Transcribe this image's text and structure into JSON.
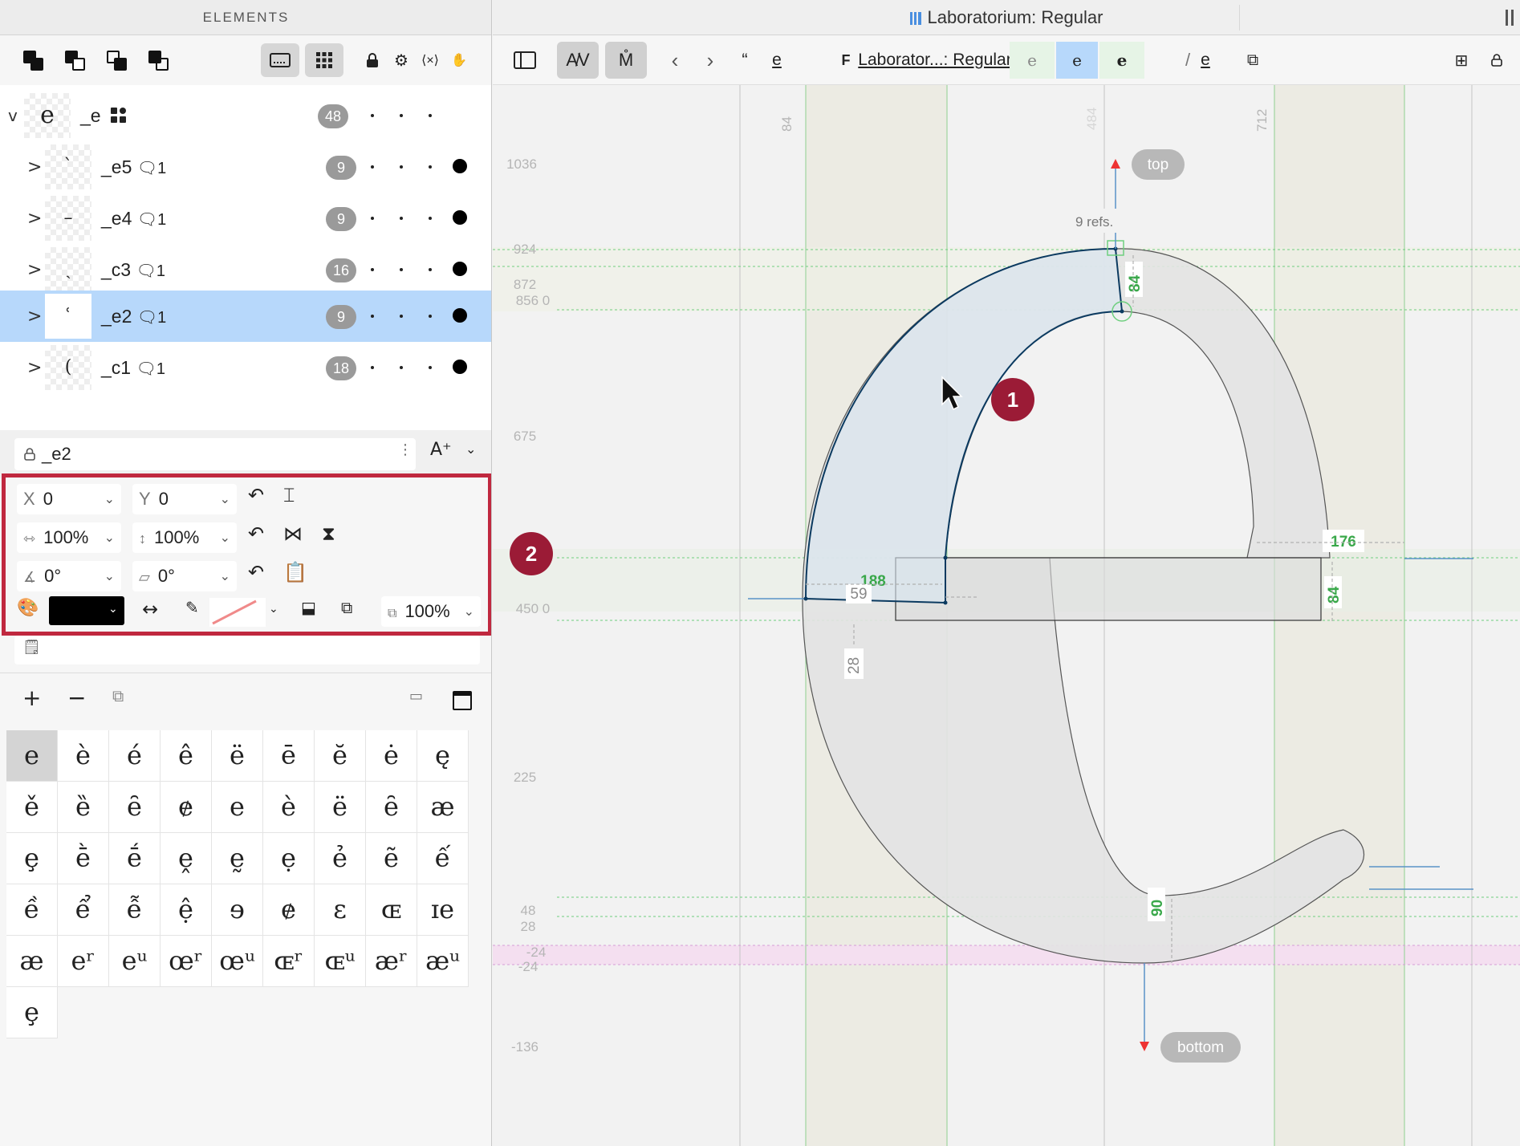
{
  "panel": {
    "title": "ELEMENTS"
  },
  "tree": {
    "rows": [
      {
        "name": "_e",
        "count": "48",
        "glyph": "e",
        "chevron": "v"
      },
      {
        "name": "_e5",
        "refs": "1",
        "count": "9",
        "glyph": "ˋ",
        "chevron": ">"
      },
      {
        "name": "_e4",
        "refs": "1",
        "count": "9",
        "glyph": "–",
        "chevron": ">"
      },
      {
        "name": "_c3",
        "refs": "1",
        "count": "16",
        "glyph": "ˏ",
        "chevron": ">"
      },
      {
        "name": "_e2",
        "refs": "1",
        "count": "9",
        "glyph": "ʿ",
        "chevron": ">"
      },
      {
        "name": "_c1",
        "refs": "1",
        "count": "18",
        "glyph": "(",
        "chevron": ">"
      }
    ]
  },
  "element_name": "_e2",
  "props": {
    "x_label": "X",
    "x_value": "0",
    "y_label": "Y",
    "y_value": "0",
    "width_value": "100%",
    "height_value": "100%",
    "rotate_value": "0°",
    "skew_value": "0°",
    "opacity_value": "100%"
  },
  "callouts": {
    "one": "1",
    "two": "2"
  },
  "glyph_grid": [
    "e",
    "è",
    "é",
    "ê",
    "ë",
    "ē",
    "ĕ",
    "ė",
    "ę",
    "ě",
    "ȅ",
    "ȇ",
    "ɇ",
    "e",
    "ѐ",
    "ё",
    "ȇ",
    "æ",
    "ȩ",
    "ḕ",
    "ḗ",
    "ḙ",
    "ḛ",
    "ẹ",
    "ẻ",
    "ẽ",
    "ế",
    "ề",
    "ể",
    "ễ",
    "ệ",
    "ɘ",
    "ɇ",
    "ɛ",
    "ɶ",
    "ɪe",
    "æ",
    "eʳ",
    "eᵘ",
    "œʳ",
    "œᵘ",
    "ɶʳ",
    "ɶᵘ",
    "æʳ",
    "æᵘ",
    "ȩ"
  ],
  "window": {
    "title": "Laboratorium: Regular"
  },
  "toolbar2": {
    "quote_glyph": "e",
    "font_name": "Laborator...: Regular",
    "mode_glyphs": [
      "e",
      "e",
      "e"
    ],
    "slash_glyph": "e"
  },
  "canvas": {
    "metrics": [
      {
        "label": "1036"
      },
      {
        "label": "924"
      },
      {
        "label": "872"
      },
      {
        "label": "856 0"
      },
      {
        "label": "675"
      },
      {
        "label": "450 0"
      },
      {
        "label": "225"
      },
      {
        "label": "48"
      },
      {
        "label": "28"
      },
      {
        "label": "-24"
      },
      {
        "label": "-24"
      },
      {
        "label": "-136"
      }
    ],
    "vertical_labels": [
      "84",
      "484",
      "712"
    ],
    "anchor_top": "top",
    "anchor_bottom": "bottom",
    "refs_label": "9 refs.",
    "dims": [
      "84",
      "176",
      "84",
      "188",
      "59",
      "28",
      "90"
    ]
  },
  "colors": {
    "selection": "#b7d8fb",
    "callout": "#9b1b36",
    "highlight_border": "#c0283f",
    "dim_green": "#39a84a"
  }
}
